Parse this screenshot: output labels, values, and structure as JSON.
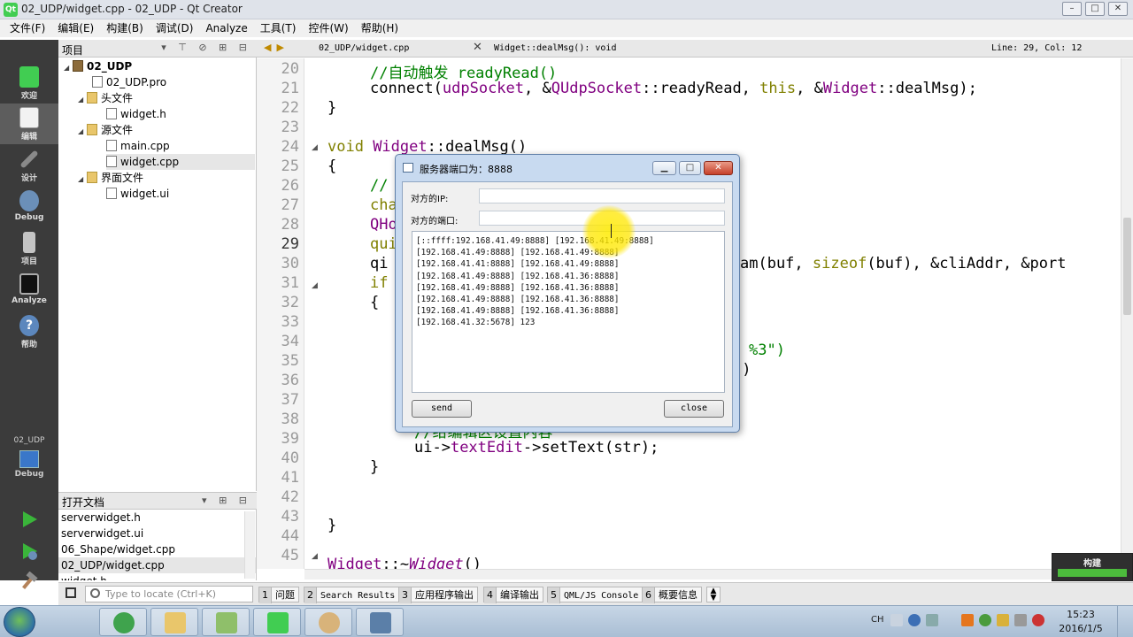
{
  "window": {
    "title": "02_UDP/widget.cpp - 02_UDP - Qt Creator",
    "controls": [
      "–",
      "□",
      "✕"
    ]
  },
  "menubar": {
    "items": [
      "文件(F)",
      "编辑(E)",
      "构建(B)",
      "调试(D)",
      "Analyze",
      "工具(T)",
      "控件(W)",
      "帮助(H)"
    ]
  },
  "modes": {
    "items": [
      {
        "label": "欢迎",
        "icon": "qt-logo-icon"
      },
      {
        "label": "编辑",
        "icon": "edit-document-icon"
      },
      {
        "label": "设计",
        "icon": "design-pen-icon"
      },
      {
        "label": "Debug",
        "icon": "debug-bug-icon"
      },
      {
        "label": "项目",
        "icon": "project-wrench-icon"
      },
      {
        "label": "Analyze",
        "icon": "analyze-monitor-icon"
      },
      {
        "label": "帮助",
        "icon": "help-question-icon"
      }
    ],
    "kit_name": "02_UDP",
    "kit_mode": "Debug"
  },
  "project_panel": {
    "title": "项目",
    "tree": [
      {
        "label": "02_UDP",
        "icon": "project-icon"
      },
      {
        "label": "02_UDP.pro",
        "icon": "pro-file-icon"
      },
      {
        "label": "头文件",
        "icon": "folder-icon"
      },
      {
        "label": "widget.h",
        "icon": "header-file-icon"
      },
      {
        "label": "源文件",
        "icon": "folder-icon"
      },
      {
        "label": "main.cpp",
        "icon": "cpp-file-icon"
      },
      {
        "label": "widget.cpp",
        "icon": "cpp-file-icon"
      },
      {
        "label": "界面文件",
        "icon": "folder-icon"
      },
      {
        "label": "widget.ui",
        "icon": "ui-file-icon"
      }
    ]
  },
  "open_docs": {
    "title": "打开文档",
    "items": [
      "serverwidget.h",
      "serverwidget.ui",
      "06_Shape/widget.cpp",
      "02_UDP/widget.cpp",
      "widget.h"
    ]
  },
  "editor_toolbar": {
    "file": "02_UDP/widget.cpp",
    "function": "Widget::dealMsg(): void",
    "cursor": "Line: 29, Col: 12"
  },
  "code": {
    "line_numbers": [
      "20",
      "21",
      "22",
      "23",
      "24",
      "25",
      "26",
      "27",
      "28",
      "29",
      "30",
      "31",
      "32",
      "33",
      "34",
      "35",
      "36",
      "37",
      "38",
      "39",
      "40",
      "41",
      "42",
      "43",
      "44",
      "45"
    ],
    "fragments": {
      "l20": "//自动触发 readyRead()",
      "l21a": "connect(",
      "l21b": "udpSocket",
      "l21c": ", &",
      "l21d": "QUdpSocket",
      "l21e": "::readyRead, ",
      "l21f": "this",
      "l21g": ", &",
      "l21h": "Widget",
      "l21i": "::dealMsg);",
      "l22": "}",
      "l24a": "void ",
      "l24b": "Widget",
      "l24c": "::dealMsg()",
      "l25": "{",
      "l26": "//",
      "l27": "cha",
      "l28": "QHo",
      "l29": "qui",
      "l30a": "qi",
      "l30b": "am(buf, ",
      "l30c": "sizeof",
      "l30d": "(buf), &cliAddr, &port",
      "l31": "if",
      "l32": "{",
      "l34": "%3\")",
      "l35": "))",
      "l38": "//给编辑区设置内容",
      "l39a": "ui->",
      "l39b": "textEdit",
      "l39c": "->setText(str);",
      "l40": "}",
      "l43": "}",
      "l45a": "Widget",
      "l45b": "::~",
      "l45c": "Widget",
      "l45d": "()"
    }
  },
  "build_progress": {
    "label": "构建",
    "fraction": 1.0
  },
  "output_pane": {
    "locator_placeholder": "Type to locate (Ctrl+K)",
    "tabs": [
      {
        "num": "1",
        "label": "问题"
      },
      {
        "num": "2",
        "label": "Search Results"
      },
      {
        "num": "3",
        "label": "应用程序输出"
      },
      {
        "num": "4",
        "label": "编译输出"
      },
      {
        "num": "5",
        "label": "QML/JS Console"
      },
      {
        "num": "6",
        "label": "概要信息"
      }
    ]
  },
  "dialog": {
    "title": "服务器端口为：8888",
    "ip_label": "对方的IP:",
    "ip_value": "",
    "port_label": "对方的端口:",
    "port_value": "",
    "log": [
      "[::ffff:192.168.41.49:8888] [192.168.41.49:8888]",
      "[192.168.41.49:8888] [192.168.41.49:8888]",
      "[192.168.41.41:8888] [192.168.41.49:8888]",
      "[192.168.41.49:8888] [192.168.41.36:8888]",
      "[192.168.41.49:8888] [192.168.41.36:8888]",
      "[192.168.41.49:8888] [192.168.41.36:8888]",
      "[192.168.41.49:8888] [192.168.41.36:8888]",
      "[192.168.41.32:5678] 123"
    ],
    "send_label": "send",
    "close_label": "close"
  },
  "taskbar": {
    "ime": "CH",
    "time": "15:23",
    "date": "2016/1/5"
  },
  "colors": {
    "mode_bar": "#3b3b3b",
    "comment": "#008000",
    "keyword": "#808000",
    "type": "#800080",
    "build_ok": "#4cbb3c"
  }
}
